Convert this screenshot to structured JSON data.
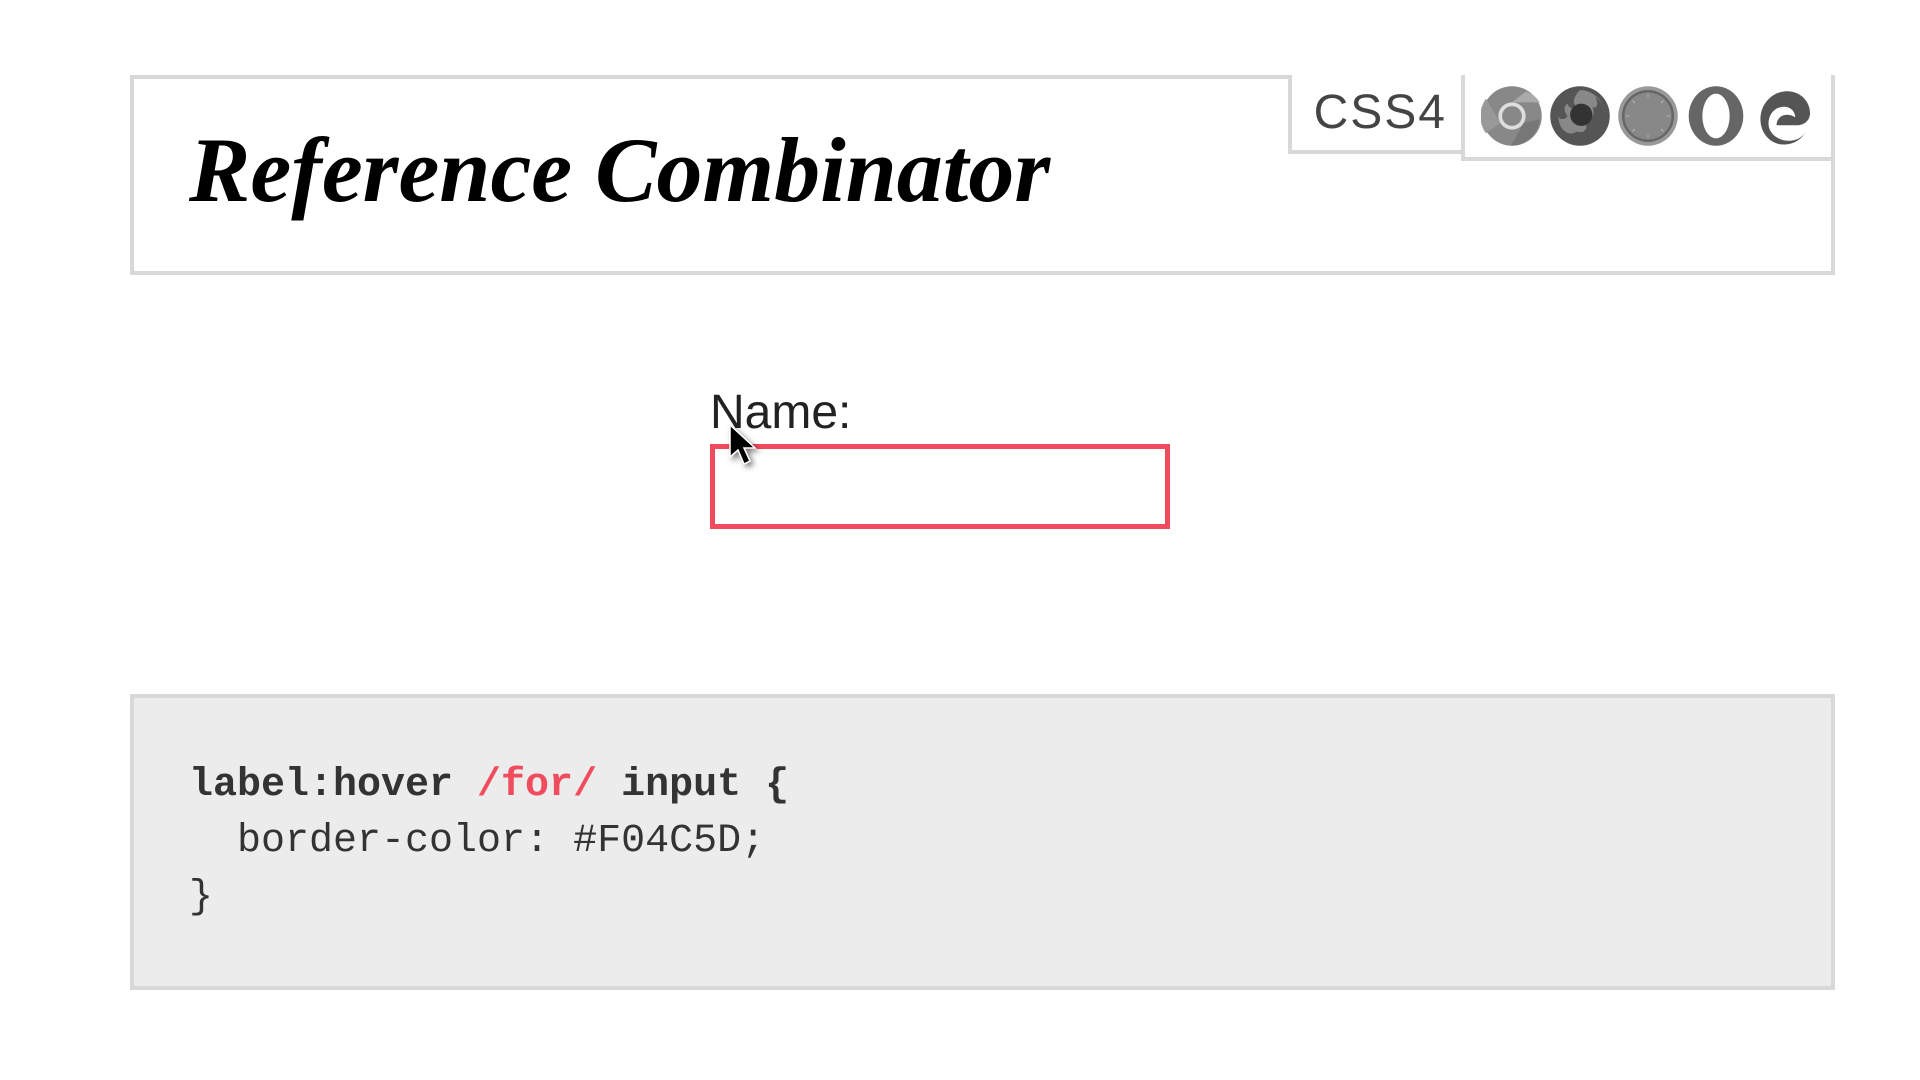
{
  "header": {
    "title": "Reference Combinator",
    "css_version": "CSS4"
  },
  "demo": {
    "label": "Name:",
    "input_value": "",
    "border_color": "#F04C5D"
  },
  "code": {
    "selector_part1": "label:hover ",
    "selector_highlight": "/for/",
    "selector_part2": " input {",
    "property_line": "  border-color: #F04C5D;",
    "closing": "}"
  }
}
